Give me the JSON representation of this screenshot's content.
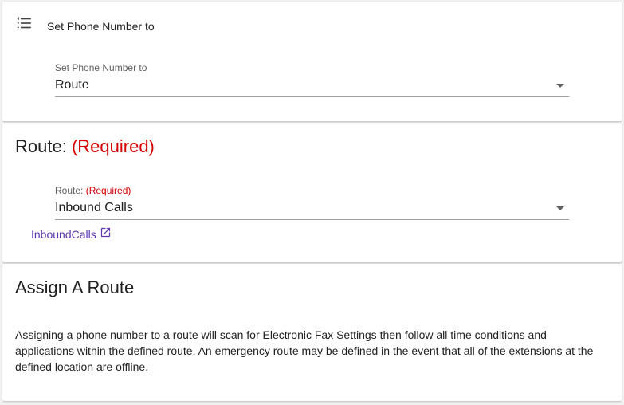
{
  "header": {
    "title": "Set Phone Number to",
    "icon": "list-numbered-icon"
  },
  "set_phone_number": {
    "label": "Set Phone Number to",
    "value": "Route"
  },
  "route_section": {
    "title": "Route:",
    "required_text": "(Required)",
    "field_label": "Route:",
    "field_required": "(Required)",
    "value": "Inbound Calls",
    "link_text": "InboundCalls",
    "link_icon": "open-in-new-icon"
  },
  "assign_section": {
    "title": "Assign A Route",
    "description": "Assigning a phone number to a route will scan for Electronic Fax Settings then follow all time conditions and applications within the defined route. An emergency route may be defined in the event that all of the extensions at the defined location are offline."
  },
  "colors": {
    "required": "#d50000",
    "link": "#5e35b1",
    "background": "#f1f1f1"
  }
}
